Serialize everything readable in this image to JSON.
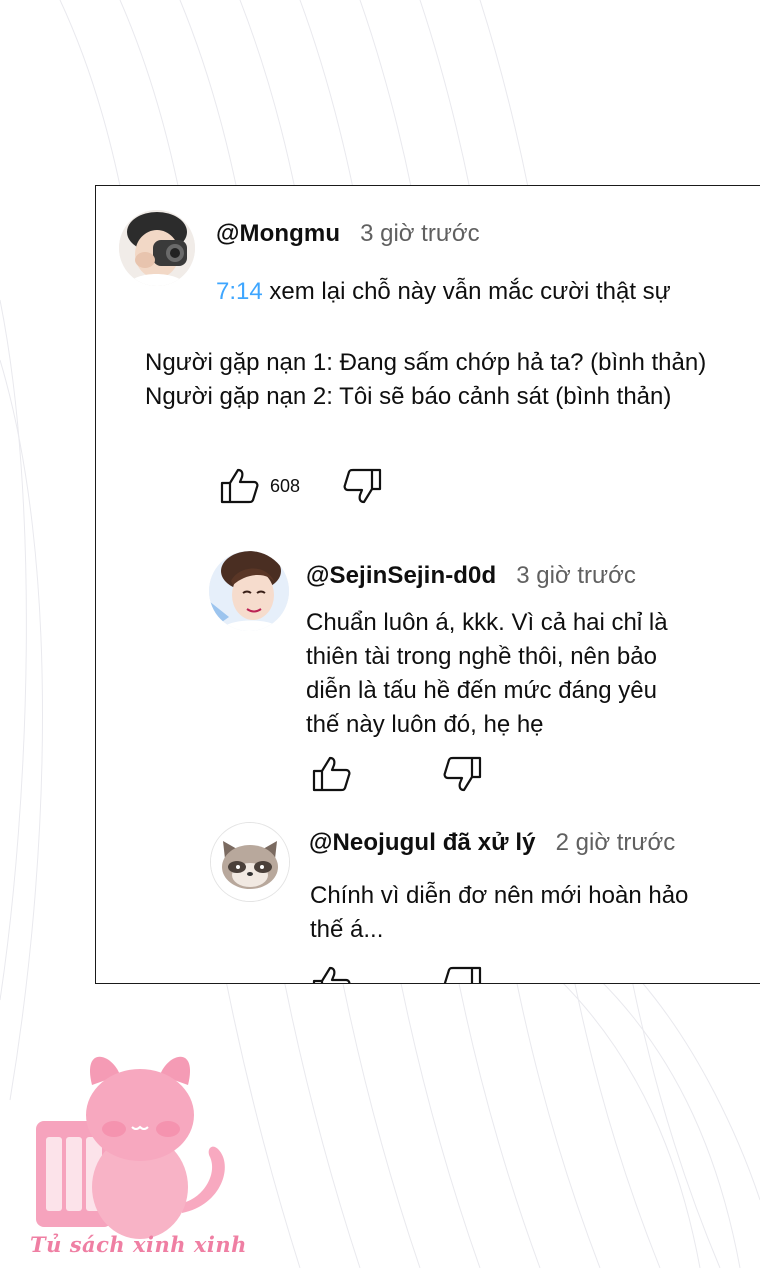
{
  "comment": {
    "handle": "@Mongmu",
    "time": "3 giờ trước",
    "timestamp": "7:14",
    "line1_rest": " xem lại chỗ này vẫn mắc cười thật sự",
    "line2": "Người gặp nạn 1: Đang sấm chớp hả ta? (bình thản)",
    "line3": "Người gặp nạn 2: Tôi sẽ báo cảnh sát (bình thản)",
    "likes": "608"
  },
  "replies": [
    {
      "handle": "@SejinSejin-d0d",
      "time": "3 giờ trước",
      "lines": [
        "Chuẩn luôn á, kkk. Vì cả hai chỉ là",
        "thiên tài trong nghề thôi, nên bảo",
        "diễn là tấu hề đến mức đáng yêu",
        "thế này luôn đó, hẹ hẹ"
      ]
    },
    {
      "handle": "@Neojugul đã xử lý",
      "time": "2 giờ trước",
      "lines": [
        "Chính vì diễn đơ nên mới hoàn hảo",
        "thế á..."
      ]
    }
  ],
  "watermark": {
    "text": "Tủ sách xinh xinh",
    "color": "#ef7fa3"
  },
  "icons": [
    "like-icon",
    "dislike-icon"
  ]
}
